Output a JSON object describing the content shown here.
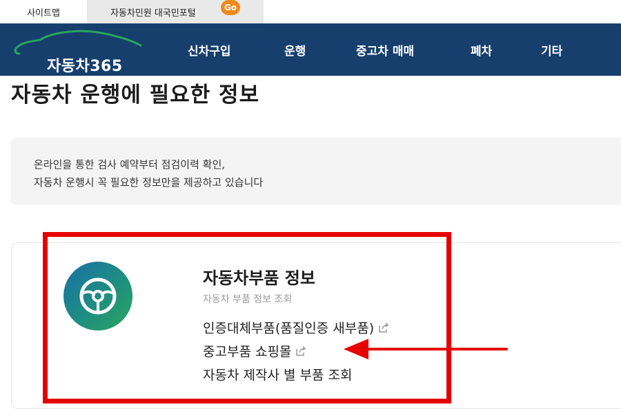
{
  "topbar": {
    "sitemap": "사이트맵",
    "portal": "자동차민원 대국민포털",
    "go_badge": "Go"
  },
  "header": {
    "logo_text": "자동차365",
    "nav": [
      "신차구입",
      "운행",
      "중고차 매매",
      "폐차",
      "기타"
    ]
  },
  "page": {
    "title": "자동차 운행에 필요한 정보",
    "intro": [
      "온라인을 통한 검사 예약부터 점검이력 확인,",
      "자동차 운행시 꼭 필요한 정보만을 제공하고 있습니다"
    ]
  },
  "card": {
    "icon": "steering-wheel-icon",
    "title": "자동차부품 정보",
    "subtitle": "자동차 부품 정보 조회",
    "links": [
      {
        "label": "인증대체부품(품질인증 새부품)",
        "external": true
      },
      {
        "label": "중고부품 쇼핑몰",
        "external": true
      },
      {
        "label": "자동차 제작사 별 부품 조회",
        "external": false
      }
    ]
  },
  "annotation": {
    "color": "#e60000"
  },
  "colors": {
    "header_bg": "#163f6e",
    "go_badge": "#f08a1c",
    "icon_gradient": [
      "#1b6fa6",
      "#2aa45e"
    ]
  }
}
